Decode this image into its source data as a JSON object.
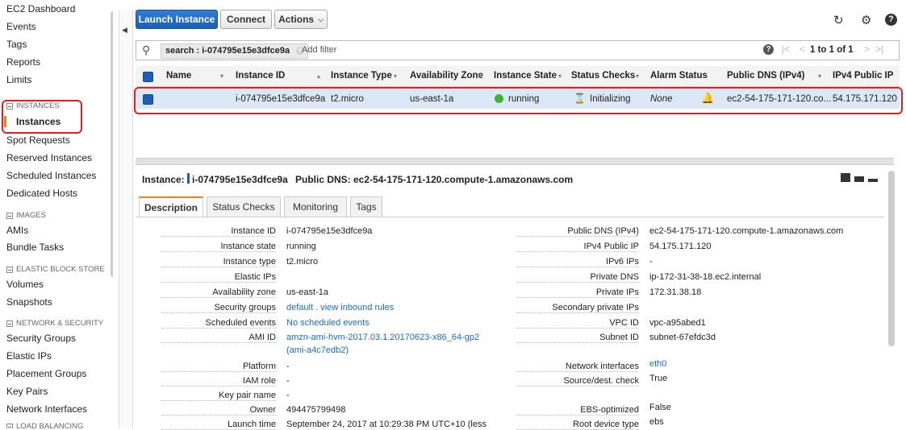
{
  "sidebar": {
    "items": [
      {
        "label": "EC2 Dashboard"
      },
      {
        "label": "Events"
      },
      {
        "label": "Tags"
      },
      {
        "label": "Reports"
      },
      {
        "label": "Limits"
      }
    ],
    "sections": [
      {
        "title": "INSTANCES",
        "items": [
          "Instances",
          "Spot Requests",
          "Reserved Instances",
          "Scheduled Instances",
          "Dedicated Hosts"
        ]
      },
      {
        "title": "IMAGES",
        "items": [
          "AMIs",
          "Bundle Tasks"
        ]
      },
      {
        "title": "ELASTIC BLOCK STORE",
        "items": [
          "Volumes",
          "Snapshots"
        ]
      },
      {
        "title": "NETWORK & SECURITY",
        "items": [
          "Security Groups",
          "Elastic IPs",
          "Placement Groups",
          "Key Pairs",
          "Network Interfaces"
        ]
      },
      {
        "title": "LOAD BALANCING",
        "items": []
      }
    ],
    "active_item": "Instances"
  },
  "toolbar": {
    "launch_label": "Launch Instance",
    "connect_label": "Connect",
    "actions_label": "Actions"
  },
  "search": {
    "token_label": "search : i-074795e15e3dfce9a",
    "placeholder": "Add filter",
    "pagination": "1 to 1 of 1"
  },
  "table": {
    "headers": [
      "Name",
      "Instance ID",
      "Instance Type",
      "Availability Zone",
      "Instance State",
      "Status Checks",
      "Alarm Status",
      "Public DNS (IPv4)",
      "IPv4 Public IP"
    ],
    "rows": [
      {
        "name": "",
        "instance_id": "i-074795e15e3dfce9a",
        "instance_type": "t2.micro",
        "availability_zone": "us-east-1a",
        "instance_state": "running",
        "status_checks": "Initializing",
        "alarm_status": "None",
        "public_dns": "ec2-54-175-171-120.co...",
        "public_ip": "54.175.171.120"
      }
    ]
  },
  "detail": {
    "instance_label": "Instance:",
    "instance_id": "i-074795e15e3dfce9a",
    "public_dns_label": "Public DNS: ec2-54-175-171-120.compute-1.amazonaws.com",
    "tabs": [
      "Description",
      "Status Checks",
      "Monitoring",
      "Tags"
    ],
    "left": [
      {
        "k": "Instance ID",
        "v": "i-074795e15e3dfce9a"
      },
      {
        "k": "Instance state",
        "v": "running"
      },
      {
        "k": "Instance type",
        "v": "t2.micro"
      },
      {
        "k": "Elastic IPs",
        "v": ""
      },
      {
        "k": "Availability zone",
        "v": "us-east-1a"
      },
      {
        "k": "Security groups",
        "v": "default . view inbound rules"
      },
      {
        "k": "Scheduled events",
        "v": "No scheduled events"
      },
      {
        "k": "AMI ID",
        "v": "amzn-ami-hvm-2017.03.1.20170623-x86_64-gp2",
        "v2": "(ami-a4c7edb2)"
      },
      {
        "k": "Platform",
        "v": "-"
      },
      {
        "k": "IAM role",
        "v": "-"
      },
      {
        "k": "Key pair name",
        "v": "-"
      },
      {
        "k": "Owner",
        "v": "494475799498"
      },
      {
        "k": "Launch time",
        "v": "September 24, 2017 at 10:29:38 PM UTC+10 (less"
      }
    ],
    "right": [
      {
        "k": "Public DNS (IPv4)",
        "v": "ec2-54-175-171-120.compute-1.amazonaws.com"
      },
      {
        "k": "IPv4 Public IP",
        "v": "54.175.171.120"
      },
      {
        "k": "IPv6 IPs",
        "v": "-"
      },
      {
        "k": "Private DNS",
        "v": "ip-172-31-38-18.ec2.internal"
      },
      {
        "k": "Private IPs",
        "v": "172.31.38.18"
      },
      {
        "k": "Secondary private IPs",
        "v": ""
      },
      {
        "k": "VPC ID",
        "v": "vpc-a95abed1"
      },
      {
        "k": "Subnet ID",
        "v": "subnet-67efdc3d"
      },
      {
        "k": "Network interfaces",
        "v": "eth0"
      },
      {
        "k": "Source/dest. check",
        "v": "True"
      },
      {
        "k": "EBS-optimized",
        "v": "False"
      },
      {
        "k": "Root device type",
        "v": "ebs"
      }
    ]
  },
  "colors": {
    "accent": "#e8831e",
    "primary": "#1c5fb0",
    "highlight": "#e02020",
    "selected_row": "#dde8f6",
    "running": "#3cb534"
  }
}
